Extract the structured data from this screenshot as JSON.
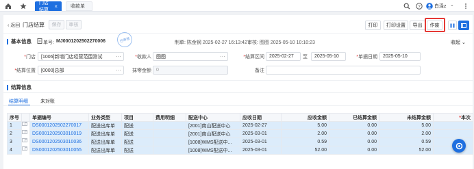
{
  "tabs": [
    {
      "label": "门店结算",
      "active": true
    },
    {
      "label": "收款单",
      "active": false
    }
  ],
  "header": {
    "user": "白泽z"
  },
  "toolbar": {
    "back": "返回",
    "title": "门店结算",
    "save": "保存",
    "audit": "审核",
    "print": "打印",
    "print_settings": "打印设置",
    "export": "导出",
    "void": "作废"
  },
  "basic_info": {
    "title": "基本信息",
    "doc_no_label": "单号:",
    "doc_no": "MJ0001202502270006",
    "stamp": "已审核",
    "creator": "制单: 陈金钢 2025-02-27 16:13:42",
    "auditor": "审核: 图图 2025-05-10 10:10:23",
    "collapse": "收起"
  },
  "form": {
    "store_label": "门店",
    "store": "[1006]新增门店经营范围测试",
    "payee_label": "收款人",
    "payee": "图图",
    "period_label": "结算区间",
    "period_from": "2025-02-27",
    "period_sep": "至",
    "period_to": "2025-05-10",
    "doc_date_label": "单据日期",
    "doc_date": "2025-05-10",
    "position_label": "结算位置",
    "position": "[0000]总部",
    "rounding_label": "抹零金额",
    "rounding": "0",
    "remark_label": "备注"
  },
  "settle": {
    "title": "结算信息",
    "sub_tabs": [
      "结算明细",
      "未对账"
    ]
  },
  "table": {
    "headers": [
      "序号",
      "",
      "单据编号",
      "业务类型",
      "项目",
      "费用明细",
      "配送中心",
      "应收日期",
      "应收金额",
      "已结算金额",
      "未结算金额",
      "本次"
    ],
    "rows": [
      {
        "idx": "1",
        "no": "DS0001202502270017",
        "type": "配送出库单",
        "item": "配送",
        "detail": "",
        "center": "[2001]南山配送中心",
        "date": "2025-02-27",
        "due": "5.00",
        "settled": "0.00",
        "unsettled": "5.00"
      },
      {
        "idx": "2",
        "no": "DS0001202503010019",
        "type": "配送出库单",
        "item": "配送",
        "detail": "",
        "center": "[2001]南山配送中心",
        "date": "2025-03-01",
        "due": "2.00",
        "settled": "0.00",
        "unsettled": "2.00"
      },
      {
        "idx": "3",
        "no": "DS0001202503010036",
        "type": "配送出库单",
        "item": "配送",
        "detail": "",
        "center": "[1008]WMS配送中...",
        "date": "2025-03-01",
        "due": "0.59",
        "settled": "0.00",
        "unsettled": "0.59"
      },
      {
        "idx": "4",
        "no": "DS0001202503010055",
        "type": "配送出库单",
        "item": "配送",
        "detail": "",
        "center": "[1008]WMS配送中...",
        "date": "2025-03-01",
        "due": "52.00",
        "settled": "0.00",
        "unsettled": "52.00"
      }
    ]
  },
  "colors": {
    "accent": "#1e6fe0",
    "highlight": "#e53935"
  }
}
